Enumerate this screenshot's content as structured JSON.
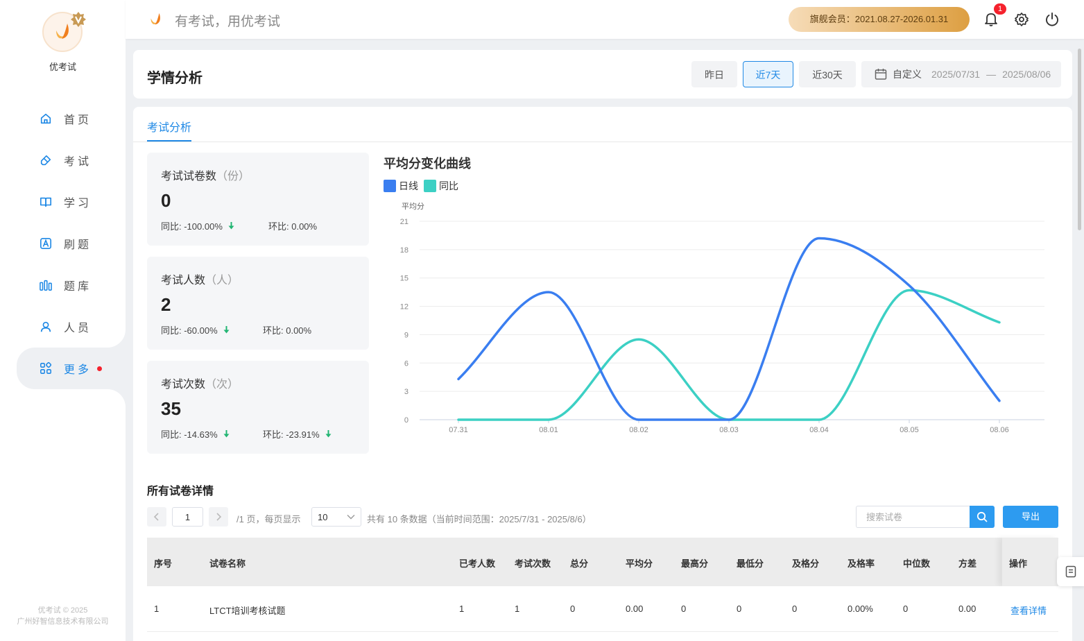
{
  "brand": {
    "name": "优考试"
  },
  "nav": [
    {
      "label": "首页",
      "icon": "home-icon"
    },
    {
      "label": "考试",
      "icon": "eraser-icon"
    },
    {
      "label": "学习",
      "icon": "book-icon"
    },
    {
      "label": "刷题",
      "icon": "letter-a-icon"
    },
    {
      "label": "题库",
      "icon": "library-icon"
    },
    {
      "label": "人员",
      "icon": "user-icon"
    },
    {
      "label": "更多",
      "icon": "apps-icon",
      "active": true
    }
  ],
  "copyright": {
    "line1": "优考试 © 2025",
    "line2": "广州好智信息技术有限公司"
  },
  "header": {
    "slogan": "有考试，用优考试",
    "member": "旗舰会员：2021.08.27-2026.01.31",
    "notification_count": "1"
  },
  "page": {
    "title": "学情分析",
    "ranges": [
      {
        "label": "昨日",
        "active": false
      },
      {
        "label": "近7天",
        "active": true
      },
      {
        "label": "近30天",
        "active": false
      }
    ],
    "custom_label": "自定义",
    "date_from": "2025/07/31",
    "date_sep": "—",
    "date_to": "2025/08/06"
  },
  "tab": {
    "label": "考试分析"
  },
  "stats": [
    {
      "label": "考试试卷数",
      "unit": "（份）",
      "value": "0",
      "yoy": "同比: -100.00%",
      "mom": "环比: 0.00%",
      "yoy_down": true,
      "mom_down": false
    },
    {
      "label": "考试人数",
      "unit": "（人）",
      "value": "2",
      "yoy": "同比: -60.00%",
      "mom": "环比: 0.00%",
      "yoy_down": true,
      "mom_down": false
    },
    {
      "label": "考试次数",
      "unit": "（次）",
      "value": "35",
      "yoy": "同比: -14.63%",
      "mom": "环比: -23.91%",
      "yoy_down": true,
      "mom_down": true
    }
  ],
  "chart_data": {
    "type": "line",
    "smooth": true,
    "title": "平均分变化曲线",
    "ylabel": "平均分",
    "xlabel": "",
    "categories": [
      "07.31",
      "08.01",
      "08.02",
      "08.03",
      "08.04",
      "08.05",
      "08.06"
    ],
    "ylim": [
      0,
      21
    ],
    "yticks": [
      0,
      3,
      6,
      9,
      12,
      15,
      18,
      21
    ],
    "legend_position": "top-left",
    "grid": true,
    "series": [
      {
        "name": "日线",
        "color": "#3a7ef0",
        "values": [
          4.3,
          13.5,
          0,
          0,
          19.2,
          14.2,
          2.0
        ]
      },
      {
        "name": "同比",
        "color": "#3cd0c4",
        "values": [
          0,
          0,
          8.5,
          0,
          0,
          13.7,
          10.3
        ]
      }
    ]
  },
  "table": {
    "title": "所有试卷详情",
    "pager": {
      "page": "1",
      "pages_text": "/1 页，每页显示",
      "size": "10",
      "total_text": "共有 10 条数据（当前时间范围：2025/7/31 - 2025/8/6）"
    },
    "search_placeholder": "搜索试卷",
    "export_label": "导出",
    "columns": [
      "序号",
      "试卷名称",
      "已考人数",
      "考试次数",
      "总分",
      "平均分",
      "最高分",
      "最低分",
      "及格分",
      "及格率",
      "中位数",
      "方差",
      "操作"
    ],
    "rows": [
      [
        "1",
        "LTCT培训考核试题",
        "1",
        "1",
        "0",
        "0.00",
        "0",
        "0",
        "0",
        "0.00%",
        "0",
        "0.00",
        "查看详情"
      ]
    ]
  }
}
